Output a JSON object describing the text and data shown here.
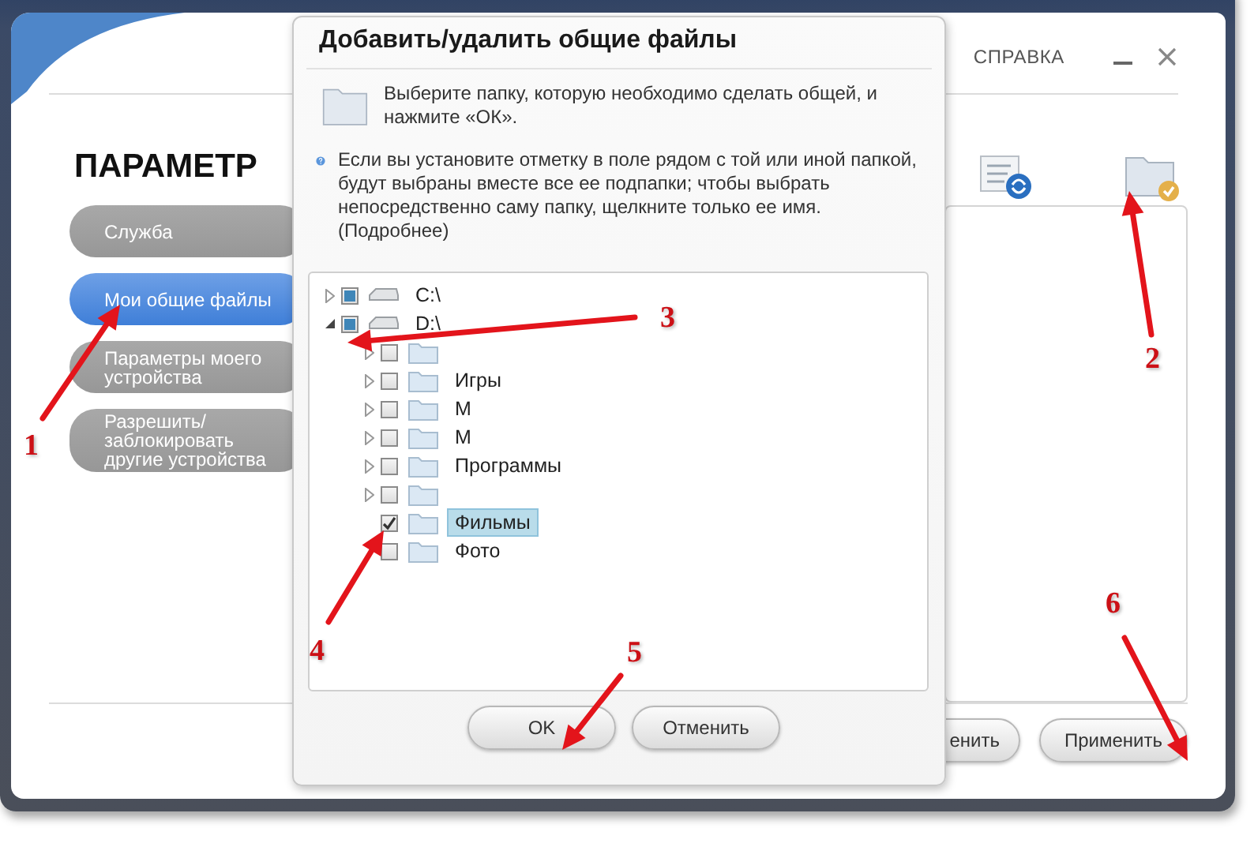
{
  "header": {
    "help": "СПРАВКА"
  },
  "page_title": "ПАРАМЕТР",
  "sidebar": {
    "items": [
      {
        "label": "Служба",
        "selected": false
      },
      {
        "label": "Мои общие файлы",
        "selected": true
      },
      {
        "label": "Параметры моего устройства",
        "selected": false
      },
      {
        "label": "Разрешить/ заблокировать другие устройства",
        "selected": false
      }
    ]
  },
  "footer": {
    "buttons": [
      {
        "label": "енить"
      },
      {
        "label": "Применить"
      }
    ]
  },
  "dialog": {
    "title": "Добавить/удалить общие файлы",
    "instruction": "Выберите папку, которую необходимо сделать общей, и нажмите «ОК».",
    "hint": "Если вы установите отметку в поле рядом с той или иной папкой, будут выбраны вместе все ее подпапки; чтобы выбрать непосредственно саму папку, щелкните только ее имя.",
    "more_link": "(Подробнее)",
    "tree": [
      {
        "kind": "drive",
        "label": "C:\\",
        "checked": false,
        "partial": true,
        "expanded": false,
        "has_children": true,
        "selected": false
      },
      {
        "kind": "drive",
        "label": "D:\\",
        "checked": false,
        "partial": true,
        "expanded": true,
        "has_children": true,
        "selected": false,
        "children": [
          {
            "kind": "folder",
            "checked": false,
            "partial": false,
            "expanded": false,
            "has_children": true,
            "selected": false
          },
          {
            "kind": "folder",
            "label": "Игры",
            "checked": false,
            "partial": false,
            "expanded": false,
            "has_children": true,
            "selected": false
          },
          {
            "kind": "folder",
            "label": "М",
            "checked": false,
            "partial": false,
            "expanded": false,
            "has_children": true,
            "selected": false
          },
          {
            "kind": "folder",
            "label": "М",
            "checked": false,
            "partial": false,
            "expanded": false,
            "has_children": true,
            "selected": false
          },
          {
            "kind": "folder",
            "label": "Программы",
            "checked": false,
            "partial": false,
            "expanded": false,
            "has_children": true,
            "selected": false
          },
          {
            "kind": "folder",
            "checked": false,
            "partial": false,
            "expanded": false,
            "has_children": true,
            "selected": false
          },
          {
            "kind": "folder",
            "label": "Фильмы",
            "checked": true,
            "partial": false,
            "has_children": false,
            "selected": true
          },
          {
            "kind": "folder",
            "label": "Фото",
            "checked": false,
            "partial": false,
            "has_children": false,
            "selected": false
          }
        ]
      }
    ],
    "buttons": [
      {
        "label": "OK"
      },
      {
        "label": "Отменить"
      }
    ]
  },
  "annotations": [
    {
      "number": "1"
    },
    {
      "number": "2"
    },
    {
      "number": "3"
    },
    {
      "number": "4"
    },
    {
      "number": "5"
    },
    {
      "number": "6"
    }
  ]
}
